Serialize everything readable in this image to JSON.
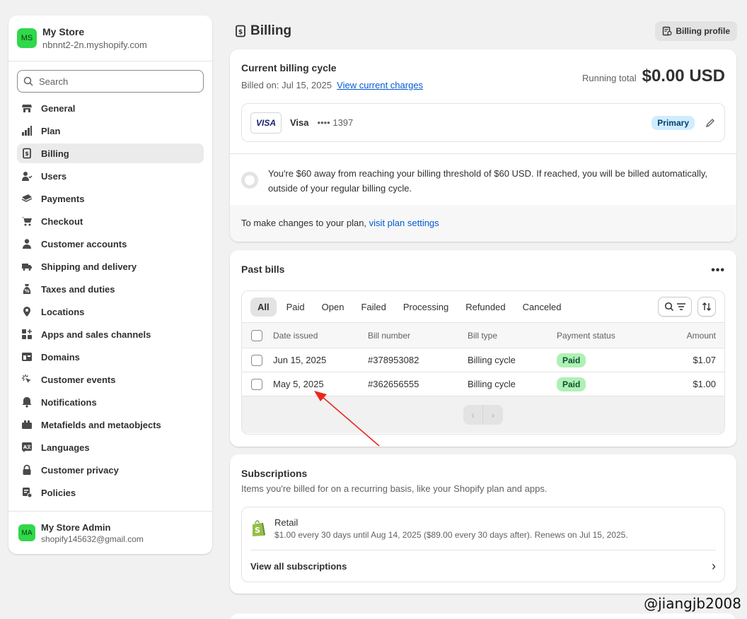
{
  "store": {
    "avatar": "MS",
    "name": "My Store",
    "domain": "nbnnt2-2n.myshopify.com"
  },
  "search": {
    "placeholder": "Search"
  },
  "nav": [
    {
      "label": "General",
      "icon": "store-icon"
    },
    {
      "label": "Plan",
      "icon": "plan-icon"
    },
    {
      "label": "Billing",
      "icon": "receipt-icon",
      "active": true
    },
    {
      "label": "Users",
      "icon": "users-icon"
    },
    {
      "label": "Payments",
      "icon": "payments-icon"
    },
    {
      "label": "Checkout",
      "icon": "cart-icon"
    },
    {
      "label": "Customer accounts",
      "icon": "person-icon"
    },
    {
      "label": "Shipping and delivery",
      "icon": "truck-icon"
    },
    {
      "label": "Taxes and duties",
      "icon": "tax-icon"
    },
    {
      "label": "Locations",
      "icon": "location-pin-icon"
    },
    {
      "label": "Apps and sales channels",
      "icon": "apps-icon"
    },
    {
      "label": "Domains",
      "icon": "globe-icon"
    },
    {
      "label": "Customer events",
      "icon": "cursor-click-icon"
    },
    {
      "label": "Notifications",
      "icon": "bell-icon"
    },
    {
      "label": "Metafields and metaobjects",
      "icon": "metafields-icon"
    },
    {
      "label": "Languages",
      "icon": "translate-icon"
    },
    {
      "label": "Customer privacy",
      "icon": "lock-icon"
    },
    {
      "label": "Policies",
      "icon": "policies-icon"
    }
  ],
  "user": {
    "avatar": "MA",
    "name": "My Store Admin",
    "email": "shopify145632@gmail.com"
  },
  "header": {
    "title": "Billing",
    "profile_button": "Billing profile"
  },
  "cycle": {
    "title": "Current billing cycle",
    "billed_on": "Billed on: Jul 15, 2025",
    "view_charges": "View current charges",
    "running_label": "Running total",
    "running_amount": "$0.00 USD",
    "card_brand_logo": "VISA",
    "card_brand": "Visa",
    "card_number": "•••• 1397",
    "primary_badge": "Primary",
    "threshold_text": "You're $60 away from reaching your billing threshold of $60 USD. If reached, you will be billed automatically, outside of your regular billing cycle.",
    "plan_text": "To make changes to your plan, ",
    "plan_link": "visit plan settings"
  },
  "past_bills": {
    "title": "Past bills",
    "more": "•••",
    "tabs": [
      "All",
      "Paid",
      "Open",
      "Failed",
      "Processing",
      "Refunded",
      "Canceled"
    ],
    "columns": {
      "date": "Date issued",
      "number": "Bill number",
      "type": "Bill type",
      "status": "Payment status",
      "amount": "Amount"
    },
    "rows": [
      {
        "date": "Jun 15, 2025",
        "number": "#378953082",
        "type": "Billing cycle",
        "status": "Paid",
        "amount": "$1.07"
      },
      {
        "date": "May 5, 2025",
        "number": "#362656555",
        "type": "Billing cycle",
        "status": "Paid",
        "amount": "$1.00"
      }
    ],
    "prev": "‹",
    "next": "›"
  },
  "subscriptions": {
    "title": "Subscriptions",
    "desc": "Items you're billed for on a recurring basis, like your Shopify plan and apps.",
    "item_name": "Retail",
    "item_desc": "$1.00 every 30 days until Aug 14, 2025 ($89.00 every 30 days after). Renews on Jul 15, 2025.",
    "view_all": "View all subscriptions",
    "chevron": "›"
  },
  "watermark": "@jiangjb2008",
  "colors": {
    "accent_link": "#005bd3",
    "paid_badge": "#aff0b5",
    "primary_badge": "#d1ecff",
    "avatar": "#30d84a",
    "annotation_arrow": "#e8281f"
  }
}
